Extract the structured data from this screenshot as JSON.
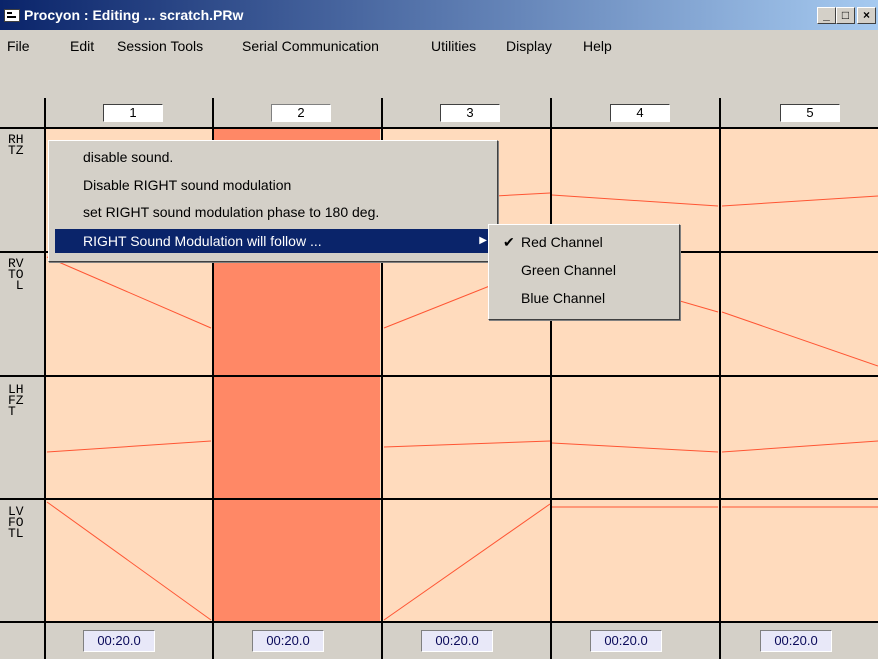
{
  "window": {
    "title": "Procyon : Editing ... scratch.PRw",
    "buttons": {
      "minimize": "_",
      "maximize": "□",
      "close": "×"
    }
  },
  "menubar": [
    "File",
    "Edit",
    "Session Tools",
    "Serial Communication",
    "Utilities",
    "Display",
    "Help"
  ],
  "columns": {
    "headers": [
      "1",
      "2",
      "3",
      "4",
      "5"
    ],
    "durations": [
      "00:20.0",
      "00:20.0",
      "00:20.0",
      "00:20.0",
      "00:20.0"
    ],
    "selected_index": 1
  },
  "rows": [
    {
      "label": "RH\nTZ"
    },
    {
      "label": "RV\nTO\n L"
    },
    {
      "label": "LH\nFZ\nT"
    },
    {
      "label": "LV\nFO\nTL"
    }
  ],
  "context_menu": {
    "items": [
      {
        "label": "disable sound."
      },
      {
        "label": "Disable RIGHT sound modulation"
      },
      {
        "label": "set RIGHT sound modulation phase to 180 deg."
      },
      {
        "label": "RIGHT Sound Modulation will follow ...",
        "has_submenu": true,
        "highlighted": true
      }
    ],
    "submenu": [
      {
        "label": "Red Channel",
        "checked": true
      },
      {
        "label": "Green Channel",
        "checked": false
      },
      {
        "label": "Blue Channel",
        "checked": false
      }
    ]
  },
  "colors": {
    "cell_fill": "#ffdbbd",
    "selected_cell_fill": "#ff8866",
    "line_color": "#ff5533",
    "menu_highlight": "#0a246a"
  }
}
